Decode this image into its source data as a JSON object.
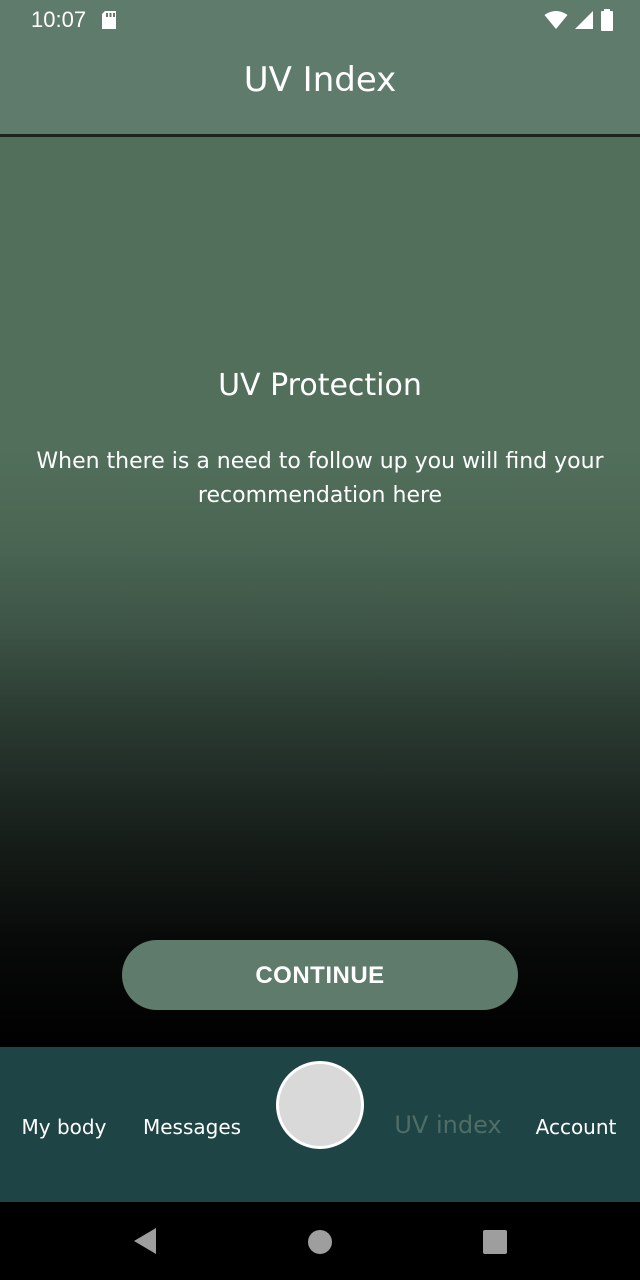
{
  "status_bar": {
    "time": "10:07",
    "icons": [
      "sd-card-icon",
      "wifi-icon",
      "signal-icon",
      "battery-icon"
    ]
  },
  "app_bar": {
    "title": "UV Index"
  },
  "main": {
    "headline": "UV Protection",
    "body": "When there is a need to follow up you will find your recommendation here",
    "continue_label": "CONTINUE"
  },
  "bottom_nav": {
    "items": [
      {
        "label": "My body",
        "active": false
      },
      {
        "label": "Messages",
        "active": false
      },
      {
        "label": "UV index",
        "active": true
      },
      {
        "label": "Account",
        "active": false
      }
    ]
  },
  "system_nav": {
    "icons": [
      "back-icon",
      "home-icon",
      "recents-icon"
    ]
  },
  "colors": {
    "primary_green": "#5f7b6c",
    "nav_background": "#1e4445",
    "active_nav_text": "#4f6d65",
    "fab": "#d9d9d9"
  }
}
